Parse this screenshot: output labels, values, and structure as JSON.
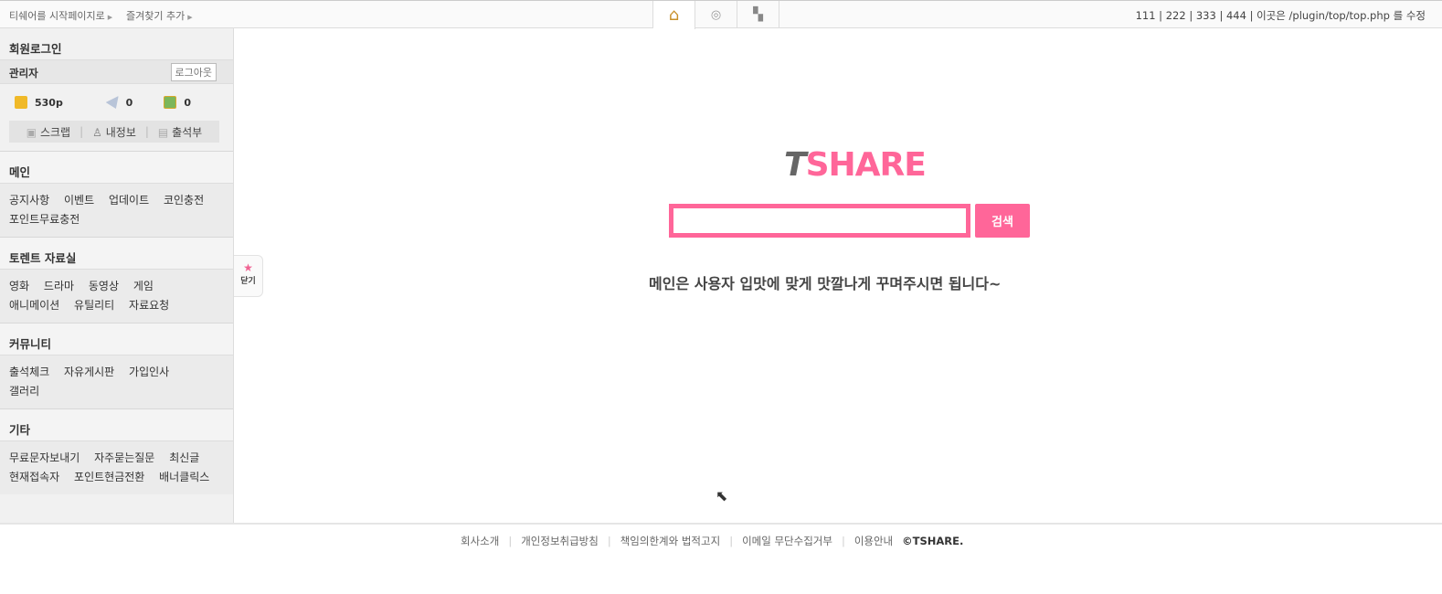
{
  "topbar": {
    "start_page": "티쉐어를 시작페이지로",
    "bookmark": "즐겨찾기 추가",
    "tabs": [
      {
        "icon": "home-icon",
        "glyph": "⌂"
      },
      {
        "icon": "search-icon",
        "glyph": "🔍"
      },
      {
        "icon": "user-chat-icon",
        "glyph": "👤"
      }
    ],
    "links": "111 | 222 | 333 | 444 | 이곳은 /plugin/top/top.php 를 수정"
  },
  "login": {
    "title": "회원로그인",
    "user": "관리자",
    "logout": "로그아웃",
    "points": "530p",
    "memo": "0",
    "coupon": "0",
    "scrap": "스크랩",
    "myinfo": "내정보",
    "attendance": "출석부"
  },
  "sections": [
    {
      "title": "메인",
      "links": [
        "공지사항",
        "이벤트",
        "업데이트",
        "코인충전",
        "포인트무료충전"
      ]
    },
    {
      "title": "토렌트 자료실",
      "links": [
        "영화",
        "드라마",
        "동영상",
        "게임",
        "애니메이션",
        "유틸리티",
        "자료요청"
      ]
    },
    {
      "title": "커뮤니티",
      "links": [
        "출석체크",
        "자유게시판",
        "가입인사",
        "갤러리"
      ]
    },
    {
      "title": "기타",
      "links": [
        "무료문자보내기",
        "자주묻는질문",
        "최신글",
        "현재접속자",
        "포인트현금전환",
        "배너클릭스"
      ]
    }
  ],
  "close_tab": "닫기",
  "main": {
    "logo_t": "T",
    "logo_rest": "SHARE",
    "search_value": "",
    "search_button": "검색",
    "message": "메인은 사용자 입맛에 맞게 맛깔나게 꾸며주시면 됩니다~"
  },
  "footer": {
    "links": [
      "회사소개",
      "개인정보취급방침",
      "책임의한계와 법적고지",
      "이메일 무단수집거부",
      "이용안내"
    ],
    "copyright": "©TSHARE."
  },
  "colors": {
    "accent": "#ff6699"
  }
}
